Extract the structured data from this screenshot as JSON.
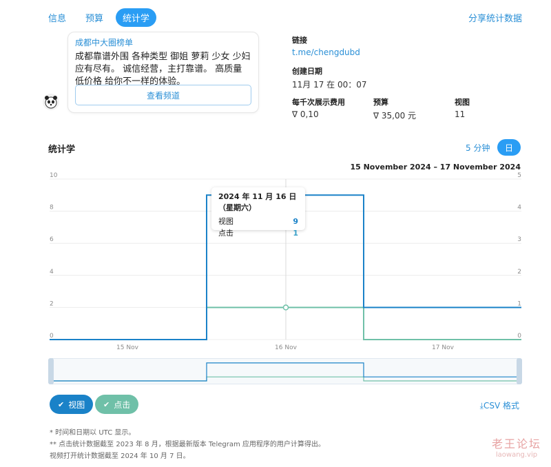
{
  "nav": {
    "tabs": [
      "信息",
      "预算",
      "统计学"
    ],
    "active": 2,
    "share_label": "分享统计数据"
  },
  "post": {
    "channel_name": "成都中大圈榜单",
    "text": "成都靠谱外围 各种类型 御姐 萝莉 少女 少妇 应有尽有。 诚信经营，主打靠谱。 高质量 低价格 给你不一样的体验。",
    "button_label": "查看频道"
  },
  "info": {
    "link_label": "链接",
    "link_value": "t.me/chengdubd",
    "created_label": "创建日期",
    "created_value": "11月 17 在 00：07",
    "cpm_label": "每千次展示费用",
    "cpm_value": "0,10",
    "budget_label": "预算",
    "budget_value": "35,00 元",
    "views_label": "视图",
    "views_value": "11",
    "currency_icon": "ton-icon"
  },
  "stats": {
    "title": "统计学",
    "period_5min": "5 分钟",
    "period_day": "日",
    "date_range": "15 November 2024 – 17 November 2024",
    "tooltip": {
      "date": "2024 年 11 月 16 日（星期六）",
      "views_label": "视图",
      "views_value": "9",
      "clicks_label": "点击",
      "clicks_value": "1"
    },
    "csv_label": "CSV 格式",
    "chip_views": "视图",
    "chip_clicks": "点击"
  },
  "colors": {
    "views": "#1a82c8",
    "clicks": "#6fc0a8",
    "accent": "#2a9df4"
  },
  "chart_data": {
    "type": "line",
    "x": [
      "15 Nov",
      "16 Nov",
      "17 Nov"
    ],
    "x_ticks": [
      "15 Nov",
      "16 Nov",
      "17 Nov"
    ],
    "series": [
      {
        "name": "视图",
        "axis": "left",
        "values": [
          0,
          9,
          2
        ]
      },
      {
        "name": "点击",
        "axis": "right",
        "values": [
          0,
          1,
          0
        ]
      }
    ],
    "y_left": {
      "ticks": [
        "0",
        "2",
        "4",
        "6",
        "8",
        "10"
      ],
      "ylim": [
        0,
        10
      ]
    },
    "y_right": {
      "ticks": [
        "0",
        "1",
        "2",
        "3",
        "4",
        "5"
      ],
      "ylim": [
        0,
        5
      ]
    },
    "step": true,
    "grid": true
  },
  "footnotes": [
    "* 时间和日期以 UTC 显示。",
    "** 点击统计数据截至 2023 年 8 月，根据最新版本 Telegram 应用程序的用户计算得出。",
    "视频打开统计数据截至 2024 年 10 月 7 日。"
  ],
  "watermark": {
    "top": "老王论坛",
    "bottom": "laowang.vip"
  }
}
